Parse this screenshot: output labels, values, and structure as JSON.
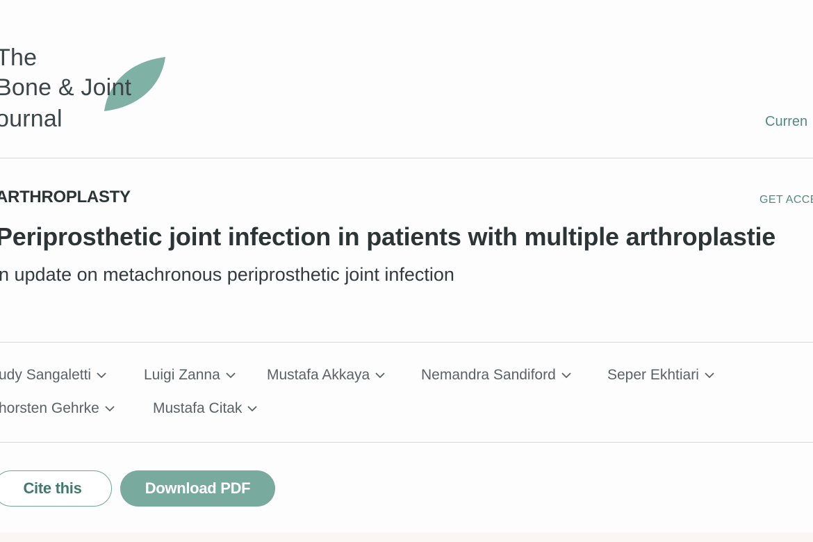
{
  "header": {
    "logo": {
      "line1": "The",
      "line2": "Bone & Joint",
      "line3": "ournal"
    },
    "nav_current": "Curren"
  },
  "article": {
    "section": "ARTHROPLASTY",
    "get_access": "GET ACCE",
    "title": "Periprosthetic joint infection in patients with multiple arthroplastie",
    "subtitle": "n update on metachronous periprosthetic joint infection",
    "authors": [
      {
        "name": "udy Sangaletti"
      },
      {
        "name": "Luigi Zanna"
      },
      {
        "name": "Mustafa Akkaya"
      },
      {
        "name": "Nemandra Sandiford"
      },
      {
        "name": "Seper Ekhtiari"
      },
      {
        "name": "horsten Gehrke"
      },
      {
        "name": "Mustafa Citak"
      }
    ]
  },
  "actions": {
    "cite": "Cite this",
    "download": "Download PDF"
  },
  "colors": {
    "accent": "#4f8c7f",
    "button_fill": "#78aa9e",
    "leaf": "#7fb1a4",
    "text_dark": "#2c3436",
    "rule": "#d3d6d7"
  },
  "icons": {
    "author_toggle": "chevron-down-icon",
    "logo_mark": "leaf-icon"
  }
}
